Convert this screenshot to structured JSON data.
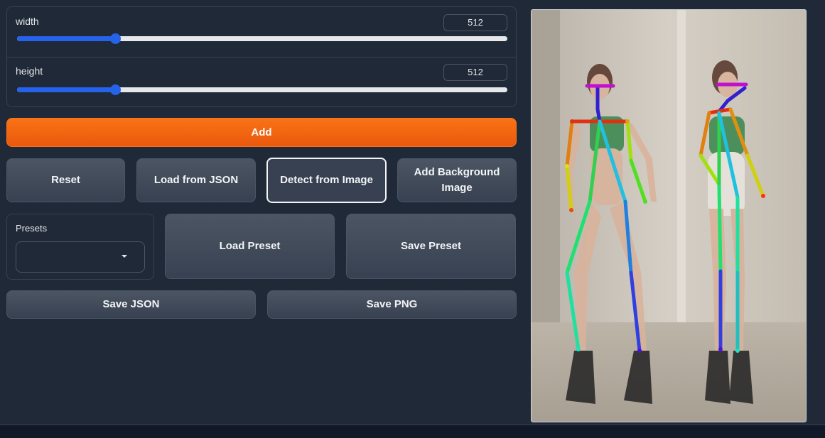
{
  "sliders": {
    "width": {
      "label": "width",
      "value": "512",
      "fraction": 0.2
    },
    "height": {
      "label": "height",
      "value": "512",
      "fraction": 0.2
    }
  },
  "buttons": {
    "add": "Add",
    "reset": "Reset",
    "load_json": "Load from JSON",
    "detect_image": "Detect from Image",
    "add_background": "Add Background Image",
    "load_preset": "Load Preset",
    "save_preset": "Save Preset",
    "save_json": "Save JSON",
    "save_png": "Save PNG"
  },
  "presets": {
    "label": "Presets",
    "selected": ""
  },
  "colors": {
    "accent": "#f97316",
    "slider": "#2563eb",
    "background": "#1f2937"
  },
  "icons": {
    "dropdown": "caret-down-icon"
  }
}
